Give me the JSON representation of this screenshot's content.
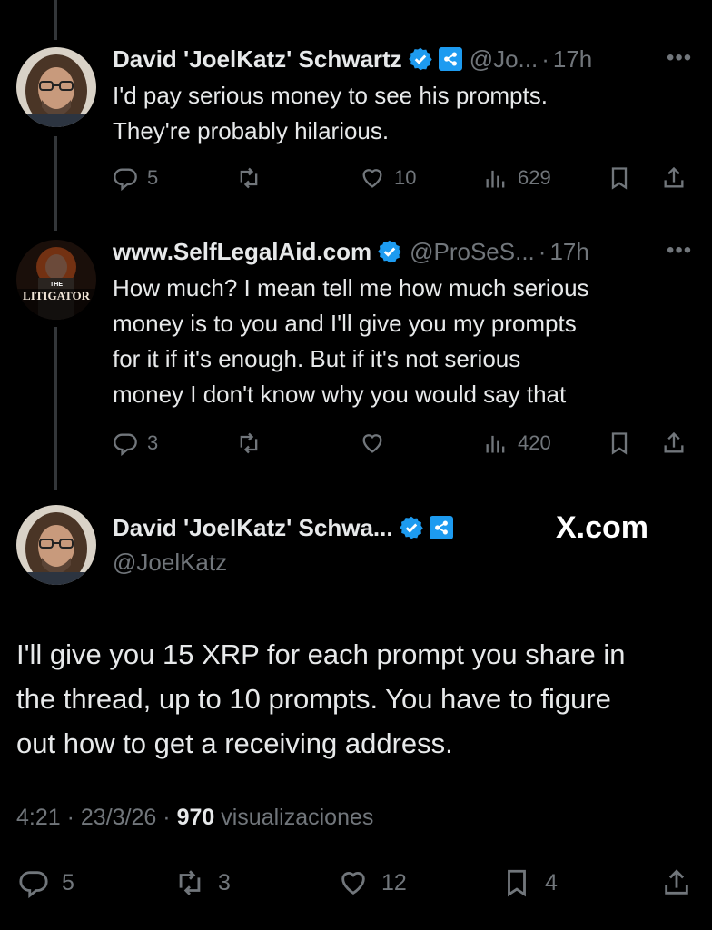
{
  "tweets": [
    {
      "name": "David 'JoelKatz' Schwartz",
      "handle": "@Jo...",
      "time": "17h",
      "text_lines": [
        "I'd pay serious money to see his prompts.",
        "They're probably hilarious."
      ],
      "replies": "5",
      "retweets": "",
      "likes": "10",
      "views": "629"
    },
    {
      "name": "www.SelfLegalAid.com",
      "handle": "@ProSeS...",
      "time": "17h",
      "avatar_text_small": "THE",
      "avatar_text": "LITIGATOR",
      "text_lines": [
        "How much? I mean tell me how much serious",
        "money is to you and I'll give you my prompts",
        "for it if it's enough. But if it's not serious",
        "money I don't know why you would say that"
      ],
      "replies": "3",
      "retweets": "",
      "likes": "",
      "views": "420"
    }
  ],
  "main_tweet": {
    "name": "David 'JoelKatz' Schwa...",
    "handle": "@JoelKatz",
    "watermark": "X.com",
    "text_lines": [
      "I'll give you 15 XRP for each prompt you share in",
      "the thread, up to 10 prompts. You have to figure",
      "out how to get a receiving address."
    ],
    "time": "4:21",
    "date": "23/3/26",
    "views_count": "970",
    "views_label": "visualizaciones",
    "replies": "5",
    "retweets": "3",
    "likes": "12",
    "bookmarks": "4"
  },
  "colors": {
    "background": "#000000",
    "text": "#e7e9ea",
    "muted": "#71767b",
    "verified": "#1d9bf0",
    "xrp_badge": "#1d9bf0"
  },
  "icons": [
    "verified-icon",
    "xrp-badge-icon",
    "more-icon",
    "reply-icon",
    "retweet-icon",
    "like-icon",
    "views-icon",
    "bookmark-icon",
    "share-icon"
  ]
}
